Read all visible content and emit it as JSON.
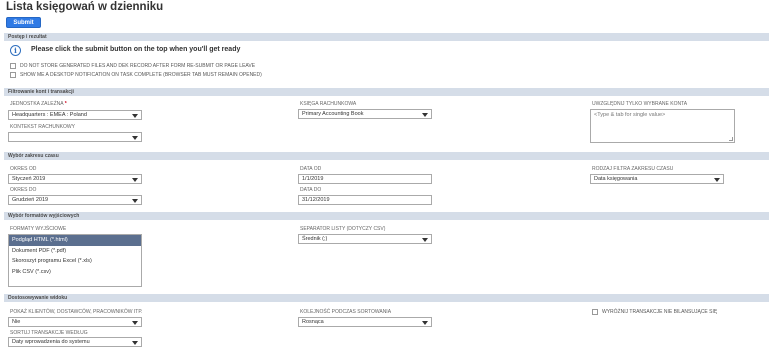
{
  "header": {
    "title": "Lista księgowań w dzienniku",
    "submit_label": "Submit"
  },
  "sections": {
    "progress": "Postęp i rezultat",
    "filter": "Filtrowanie kont i transakcji",
    "period": "Wybór zakresu czasu",
    "formats": "Wybór formatów wyjściowych",
    "view": "Dostosowywanie widoku"
  },
  "progress": {
    "info": "Please click the submit button on the top when you'll get ready",
    "checkbox1": "Do not store generated files and DEK record after form re-submit or page leave",
    "checkbox2": "Show me a desktop notification on task complete (browser tab must remain opened)"
  },
  "filter": {
    "subsidiary_label": "Jednostka zależna",
    "subsidiary_value": "Headquarters : EMEA : Poland",
    "accounting_context_label": "Kontekst rachunkowy",
    "accounting_context_value": "",
    "book_label": "Księga rachunkowa",
    "book_value": "Primary Accounting Book",
    "accounts_label": "Uwzględnij tylko wybrane konta",
    "accounts_placeholder": "<Type & tab for single value>"
  },
  "period": {
    "from_period_label": "Okres od",
    "from_period_value": "Styczeń 2019",
    "to_period_label": "Okres do",
    "to_period_value": "Grudzień 2019",
    "date_from_label": "Data od",
    "date_from_value": "1/1/2019",
    "date_to_label": "Data do",
    "date_to_value": "31/12/2019",
    "filter_type_label": "Rodzaj filtra zakresu czasu",
    "filter_type_value": "Data księgowania"
  },
  "formats": {
    "output_label": "Formaty wyjściowe",
    "options": [
      "Podgląd HTML (*.html)",
      "Dokument PDF (*.pdf)",
      "Skoroszyt programu Excel (*.xls)",
      "Plik CSV (*.csv)"
    ],
    "selected_index": 0,
    "separator_label": "Separator listy (dotyczy CSV)",
    "separator_value": "Średnik (;)"
  },
  "view": {
    "show_entities_label": "Pokaż klientów, dostawców, pracowników itp.",
    "show_entities_value": "Nie",
    "sort_order_label": "Kolejność podczas sortowania",
    "sort_order_value": "Rosnąca",
    "sort_by_label": "Sortuj transakcje według",
    "sort_by_value": "Daty wprowadzenia do systemu",
    "highlight_label": "Wyróżnij transakcje nie bilansujące się"
  }
}
